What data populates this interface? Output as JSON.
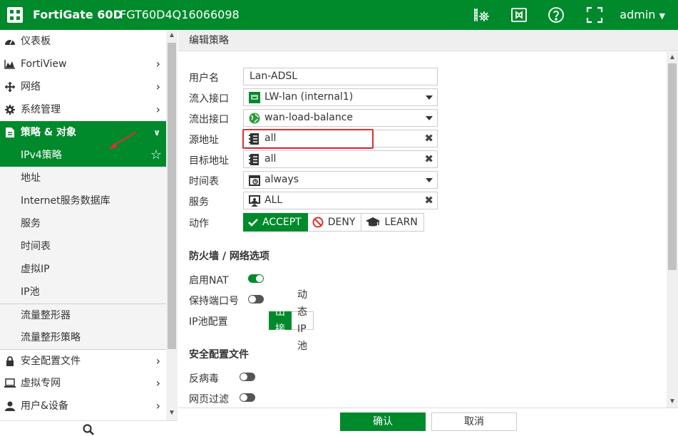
{
  "topbar": {
    "brand": "FortiGate 60D",
    "serial": "FGT60D4Q16066098",
    "user": "admin",
    "bg_color": "#008a2c",
    "icons": [
      "settings-terminal-icon",
      "video-icon",
      "help-icon",
      "fullscreen-icon"
    ]
  },
  "sidebar": {
    "items": [
      {
        "label": "仪表板",
        "icon": "dashboard-icon"
      },
      {
        "label": "FortiView",
        "icon": "chart-icon"
      },
      {
        "label": "网络",
        "icon": "network-icon"
      },
      {
        "label": "系统管理",
        "icon": "gear-icon"
      },
      {
        "label": "策略 & 对象",
        "icon": "policy-icon"
      }
    ],
    "sub_items": [
      {
        "label": "IPv4策略",
        "selected": true
      },
      {
        "label": "地址"
      },
      {
        "label": "Internet服务数据库"
      },
      {
        "label": "服务"
      },
      {
        "label": "时间表"
      },
      {
        "label": "虚拟IP"
      },
      {
        "label": "IP池"
      },
      {
        "label": "流量整形器"
      },
      {
        "label": "流量整形策略"
      }
    ],
    "bottom_items": [
      {
        "label": "安全配置文件",
        "icon": "lock-icon"
      },
      {
        "label": "虚拟专网",
        "icon": "laptop-icon"
      },
      {
        "label": "用户&设备",
        "icon": "user-icon"
      }
    ]
  },
  "main": {
    "header": "编辑策略",
    "fields": {
      "name": {
        "label": "用户名",
        "value": "Lan-ADSL"
      },
      "in_iface": {
        "label": "流入接口",
        "value": "LW-lan (internal1)"
      },
      "out_iface": {
        "label": "流出接口",
        "value": "wan-load-balance"
      },
      "src": {
        "label": "源地址",
        "value": "all"
      },
      "dst": {
        "label": "目标地址",
        "value": "all"
      },
      "schedule": {
        "label": "时间表",
        "value": "always"
      },
      "service": {
        "label": "服务",
        "value": "ALL"
      }
    },
    "action": {
      "label": "动作",
      "accept": "ACCEPT",
      "deny": "DENY",
      "learn": "LEARN",
      "selected": "ACCEPT"
    },
    "firewall_section": "防火墙 / 网络选项",
    "nat": {
      "label": "启用NAT",
      "on": true
    },
    "preserve_port": {
      "label": "保持端口号",
      "on": false
    },
    "ippool": {
      "label": "IP池配置",
      "option1": "使用流出接口地址",
      "option2": "动态IP池",
      "selected": "使用流出接口地址"
    },
    "security_section": "安全配置文件",
    "antivirus": {
      "label": "反病毒",
      "on": false
    },
    "webfilter": {
      "label": "网页过滤",
      "on": false
    }
  },
  "footer": {
    "ok": "确认",
    "cancel": "取消"
  }
}
